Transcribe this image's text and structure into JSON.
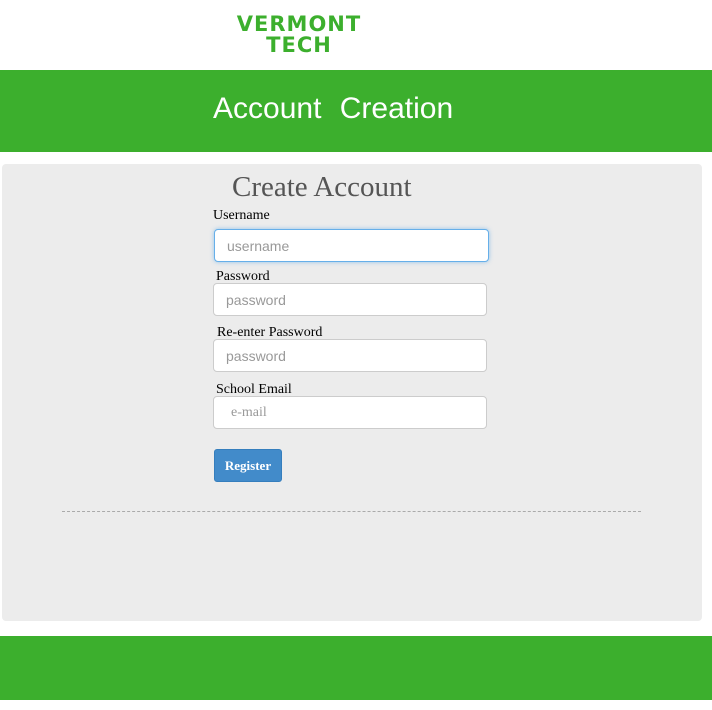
{
  "logo": {
    "line1": "VERMONT",
    "line2": "TECH"
  },
  "header": {
    "title": "Account Creation"
  },
  "form": {
    "title": "Create Account",
    "username": {
      "label": "Username",
      "placeholder": "username",
      "value": ""
    },
    "password": {
      "label": "Password",
      "placeholder": "password",
      "value": ""
    },
    "reenter_password": {
      "label": "Re-enter Password",
      "placeholder": "password",
      "value": ""
    },
    "email": {
      "label": "School Email",
      "placeholder": "e-mail",
      "value": ""
    },
    "register_label": "Register"
  },
  "colors": {
    "brand_green": "#3caf2d",
    "panel_gray": "#ececec",
    "button_blue": "#428bca"
  }
}
